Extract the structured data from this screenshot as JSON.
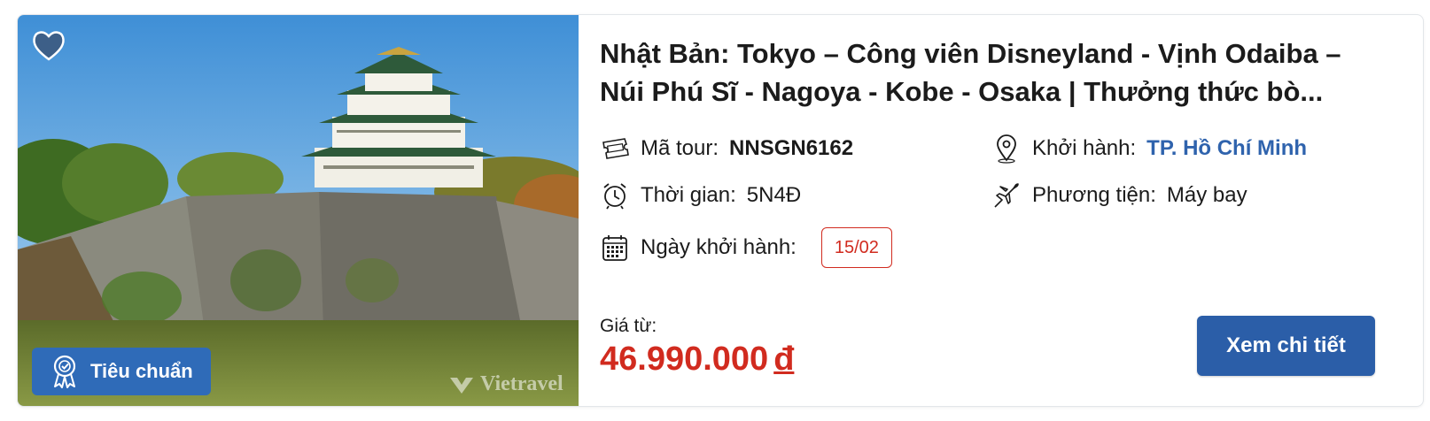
{
  "tour": {
    "title": "Nhật Bản: Tokyo – Công viên Disneyland - Vịnh Odaiba – Núi Phú Sĩ - Nagoya - Kobe - Osaka | Thưởng thức bò...",
    "badge_label": "Tiêu chuẩn",
    "watermark": "Vietravel",
    "code_label": "Mã tour:",
    "code_value": "NNSGN6162",
    "depart_label": "Khởi hành:",
    "depart_value": "TP. Hồ Chí Minh",
    "duration_label": "Thời gian:",
    "duration_value": "5N4Đ",
    "transport_label": "Phương tiện:",
    "transport_value": "Máy bay",
    "date_label": "Ngày khởi hành:",
    "date_value": "15/02",
    "price_label": "Giá từ:",
    "price_value": "46.990.000",
    "currency": "đ",
    "detail_button": "Xem chi tiết"
  },
  "icons": {
    "favorite": "heart-icon",
    "badge": "award-ribbon-icon",
    "code": "ticket-icon",
    "depart": "location-pin-icon",
    "duration": "alarm-clock-icon",
    "transport": "airplane-icon",
    "date": "calendar-icon"
  },
  "colors": {
    "accent_blue": "#2b5ea8",
    "link_blue": "#2f63ad",
    "price_red": "#d12b1f"
  }
}
